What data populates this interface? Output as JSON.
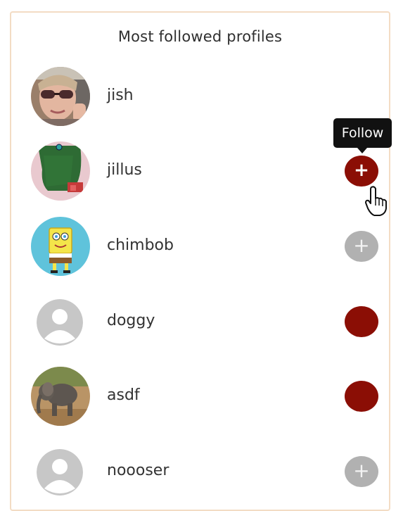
{
  "panel": {
    "title": "Most followed profiles"
  },
  "profiles": [
    {
      "username": "jish",
      "avatar": "photo-woman-sunglasses",
      "follow_button": null
    },
    {
      "username": "jillus",
      "avatar": "green-drawing",
      "follow_button": {
        "state": "hovered",
        "icon": "plus-icon",
        "color": "#8b0e05"
      }
    },
    {
      "username": "chimbob",
      "avatar": "spongebob-image",
      "follow_button": {
        "state": "disabled",
        "icon": "plus-icon",
        "color": "#b1b1b1"
      }
    },
    {
      "username": "doggy",
      "avatar": "default-user-icon",
      "follow_button": {
        "state": "active",
        "icon": null,
        "color": "#8b0e05"
      }
    },
    {
      "username": "asdf",
      "avatar": "photo-elephant",
      "follow_button": {
        "state": "active",
        "icon": null,
        "color": "#8b0e05"
      }
    },
    {
      "username": "noooser",
      "avatar": "default-user-icon",
      "follow_button": {
        "state": "disabled",
        "icon": "plus-icon",
        "color": "#b1b1b1"
      }
    }
  ],
  "tooltip": {
    "text": "Follow"
  },
  "icons": {
    "plus": "+"
  }
}
